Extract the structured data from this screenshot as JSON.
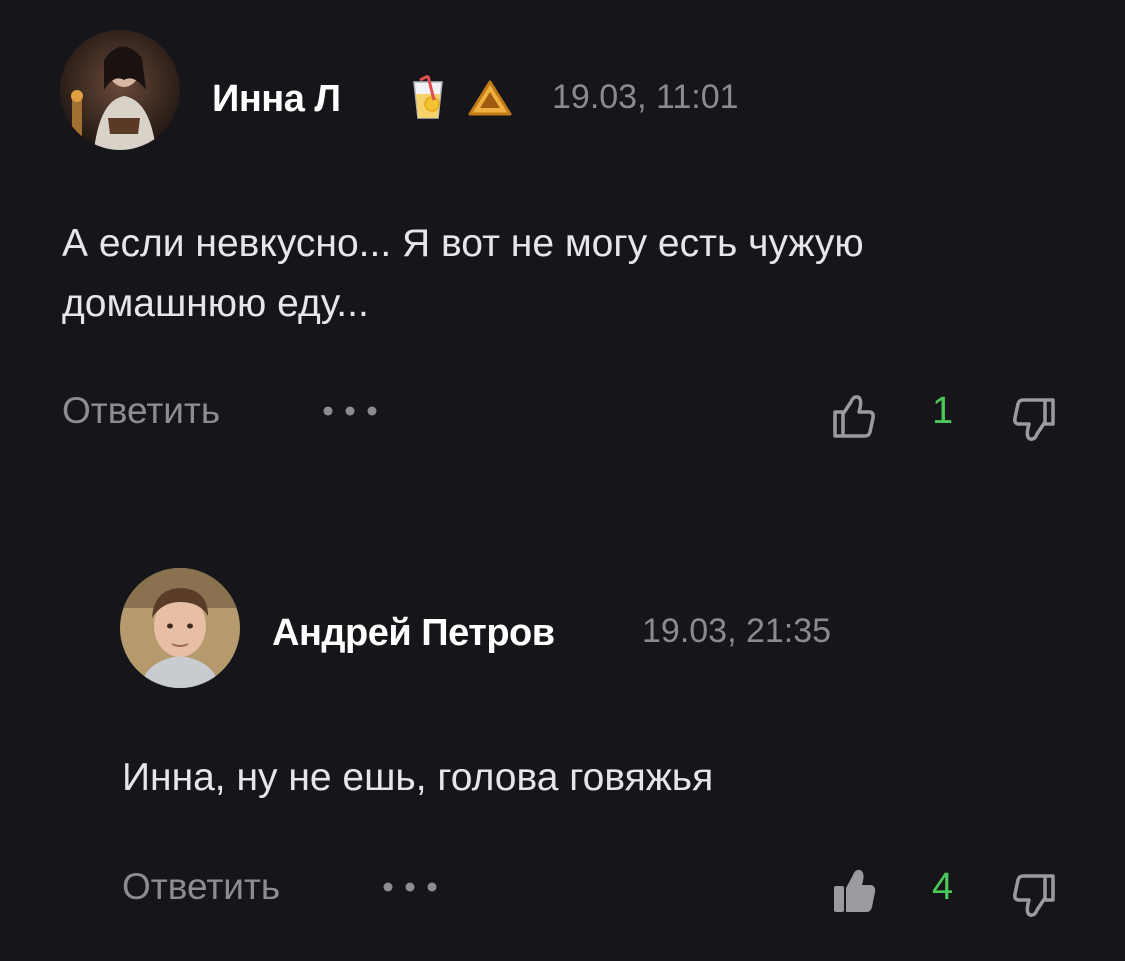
{
  "comments": [
    {
      "author": "Инна Л",
      "timestamp": "19.03, 11:01",
      "badges": [
        "juice-glass-icon",
        "cheese-wedge-icon"
      ],
      "text": "А если невкусно... Я вот не могу есть чужую\nдомашнюю еду...",
      "reply_label": "Ответить",
      "likes": "1",
      "liked": false
    },
    {
      "author": "Андрей Петров",
      "timestamp": "19.03, 21:35",
      "badges": [],
      "text": "Инна, ну не ешь, голова говяжья",
      "reply_label": "Ответить",
      "likes": "4",
      "liked": true
    }
  ],
  "colors": {
    "background": "#16161a",
    "like_count": "#4cc85a",
    "muted": "#8c8c92"
  }
}
